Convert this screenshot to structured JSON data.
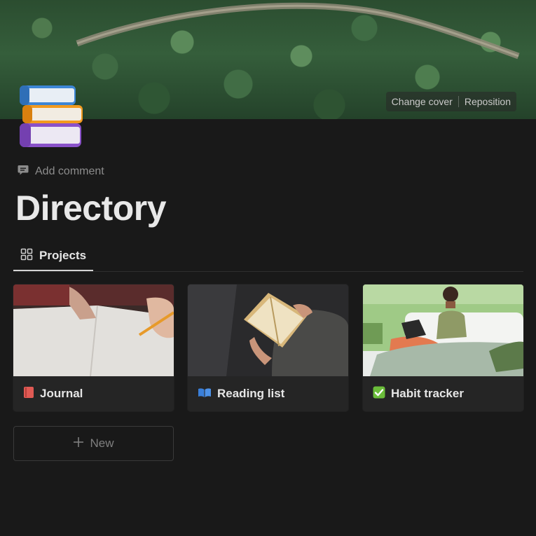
{
  "cover": {
    "change_label": "Change cover",
    "reposition_label": "Reposition"
  },
  "page": {
    "icon": "books-emoji",
    "add_comment_label": "Add comment",
    "title": "Directory"
  },
  "tabs": [
    {
      "label": "Projects",
      "icon": "gallery-grid-icon",
      "active": true
    }
  ],
  "cards": [
    {
      "label": "Journal",
      "icon": "closed-book-emoji",
      "image": "open-notebook-writing"
    },
    {
      "label": "Reading list",
      "icon": "open-book-emoji",
      "image": "person-reading-book"
    },
    {
      "label": "Habit tracker",
      "icon": "check-mark-button-emoji",
      "image": "woman-on-sofa-with-laptop"
    }
  ],
  "new_button": {
    "label": "New",
    "icon": "plus-icon"
  },
  "colors": {
    "background": "#191919",
    "card": "#252525",
    "journal_icon": "#e05a54",
    "reading_icon": "#3a7fd9",
    "habit_icon": "#6bbd3a"
  }
}
